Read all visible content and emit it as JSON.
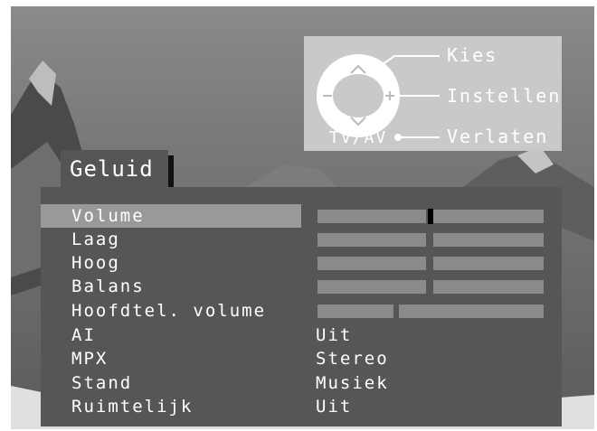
{
  "remote_legend": {
    "select_label": "Kies",
    "adjust_label": "Instellen",
    "exit_label": "Verlaten",
    "tvav_label": "TV/AV"
  },
  "menu": {
    "title": "Geluid",
    "items": [
      {
        "label": "Volume",
        "type": "slider",
        "level": 0.5,
        "selected": true
      },
      {
        "label": "Laag",
        "type": "slider",
        "level": 0.5
      },
      {
        "label": "Hoog",
        "type": "slider",
        "level": 0.5
      },
      {
        "label": "Balans",
        "type": "slider",
        "level": 0.5
      },
      {
        "label": "Hoofdtel. volume",
        "type": "slider",
        "level": 0.35
      },
      {
        "label": "AI",
        "type": "value",
        "value": "Uit"
      },
      {
        "label": "MPX",
        "type": "value",
        "value": "Stereo"
      },
      {
        "label": "Stand",
        "type": "value",
        "value": "Musiek"
      },
      {
        "label": "Ruimtelijk",
        "type": "value",
        "value": "Uit"
      }
    ]
  }
}
